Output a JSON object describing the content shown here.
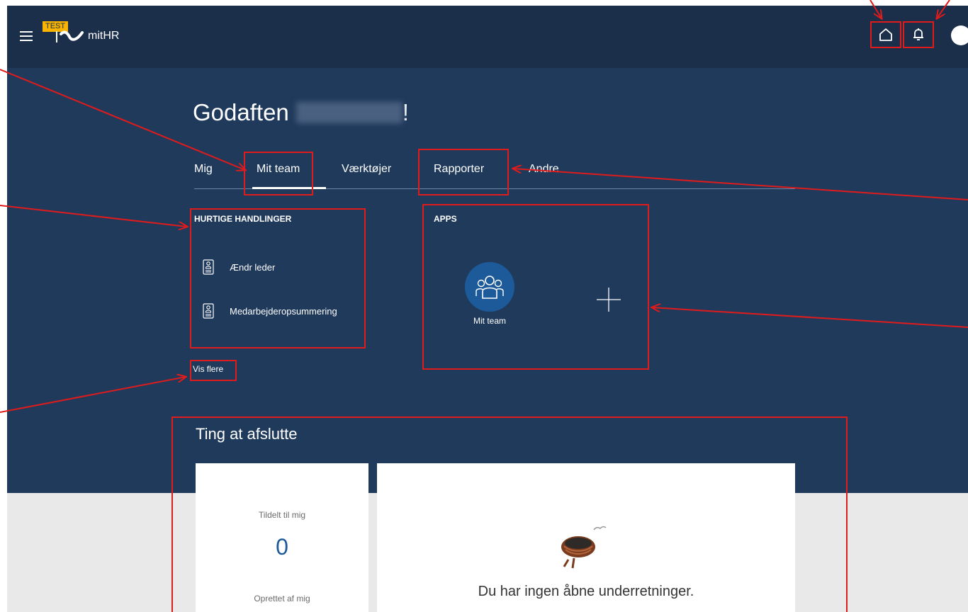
{
  "header": {
    "badge": "TEST",
    "app_name": "mitHR",
    "icons": [
      "menu-icon",
      "home-icon",
      "bell-icon",
      "avatar"
    ]
  },
  "greeting": {
    "prefix": "Godaften",
    "suffix": "!"
  },
  "tabs": [
    {
      "label": "Mig"
    },
    {
      "label": "Mit team",
      "active": true
    },
    {
      "label": "Værktøjer"
    },
    {
      "label": "Rapporter"
    },
    {
      "label": "Andre"
    }
  ],
  "quick_actions": {
    "title": "HURTIGE HANDLINGER",
    "items": [
      {
        "label": "Ændr leder",
        "icon": "badge-icon"
      },
      {
        "label": "Medarbejderopsummering",
        "icon": "badge-icon"
      }
    ],
    "more_label": "Vis flere"
  },
  "apps": {
    "title": "APPS",
    "tiles": [
      {
        "label": "Mit team",
        "icon": "team-icon"
      }
    ],
    "add_icon": "plus-icon"
  },
  "todo": {
    "title": "Ting at afslutte",
    "assigned_label": "Tildelt til mig",
    "assigned_count": "0",
    "created_label": "Oprettet af mig",
    "empty_message": "Du har ingen åbne underretninger."
  },
  "colors": {
    "header_bg": "#1b2f4a",
    "hero_bg": "#203a5c",
    "accent_blue": "#1d5a9a",
    "annotation_red": "#e01b1b",
    "badge_yellow": "#f8b400"
  }
}
